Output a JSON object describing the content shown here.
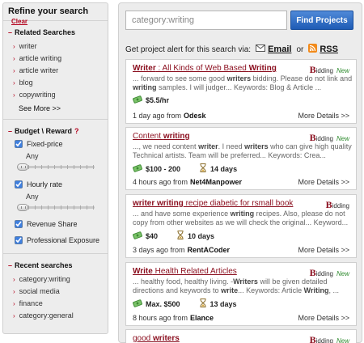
{
  "sidebar": {
    "title": "Refine your search",
    "clear": "Clear",
    "related_title": "Related Searches",
    "related": [
      "writer",
      "article writing",
      "article writer",
      "blog",
      "copywriting"
    ],
    "see_more": "See More >>",
    "budget_title": "Budget \\ Reward",
    "budget_q": "?",
    "fixed_price": "Fixed-price",
    "any1": "Any",
    "hourly_rate": "Hourly rate",
    "any2": "Any",
    "revenue_share": "Revenue Share",
    "professional_exposure": "Professional Exposure",
    "recent_title": "Recent searches",
    "recent": [
      "category:writing",
      "social media",
      "finance",
      "category:general"
    ]
  },
  "search": {
    "value": "category:writing",
    "button": "Find Projects"
  },
  "alert": {
    "text": "Get project alert for this search via:",
    "email": "Email",
    "or": "or",
    "rss": "RSS"
  },
  "bidding": {
    "big": "B",
    "rest": "idding",
    "new": "New"
  },
  "projects": [
    {
      "title_parts": [
        "Writer",
        " : All Kinds of Web Based ",
        "Writing"
      ],
      "desc": "... forward to see some good writers bidding. Please do not link and writing samples. I will judger... Keywords: Blog & Article ...",
      "budget": "$5.5/hr",
      "duration": "",
      "posted": "1 day ago from",
      "source": "Odesk",
      "more": "More Details >>",
      "is_new": true
    },
    {
      "title_parts": [
        "Content ",
        "writing",
        ""
      ],
      "desc": "..., we need content writer. I need writers who can give high quality Technical artists. Team will be preferred... Keywords: Crea...",
      "budget": "$100 - 200",
      "duration": "14 days",
      "posted": "4 hours ago from",
      "source": "Net4Manpower",
      "more": "More Details >>",
      "is_new": true
    },
    {
      "title_parts": [
        "writer writing",
        " recipe diabetic for rsmall book",
        ""
      ],
      "desc": "... and have some experience writing recipes. Also, please do not copy from other websites as we will check the original... Keyword...",
      "budget": "$40",
      "duration": "10 days",
      "posted": "3 days ago from",
      "source": "RentACoder",
      "more": "More Details >>",
      "is_new": false
    },
    {
      "title_parts": [
        "Write",
        " Health Related Articles",
        ""
      ],
      "desc": "... healthy food, healthy living. -Writers will be given detailed directions and keywords to write... Keywords: Article Writing, ...",
      "budget": "Max. $500",
      "duration": "13 days",
      "posted": "8 hours ago from",
      "source": "Elance",
      "more": "More Details >>",
      "is_new": true
    },
    {
      "title_parts": [
        "good ",
        "writers",
        ""
      ],
      "desc": "",
      "budget": "",
      "duration": "",
      "posted": "",
      "source": "",
      "more": "",
      "is_new": true
    }
  ],
  "colors": {
    "accent": "#8a0d1d",
    "button": "#2a66c2",
    "new": "#2e8b2e"
  }
}
